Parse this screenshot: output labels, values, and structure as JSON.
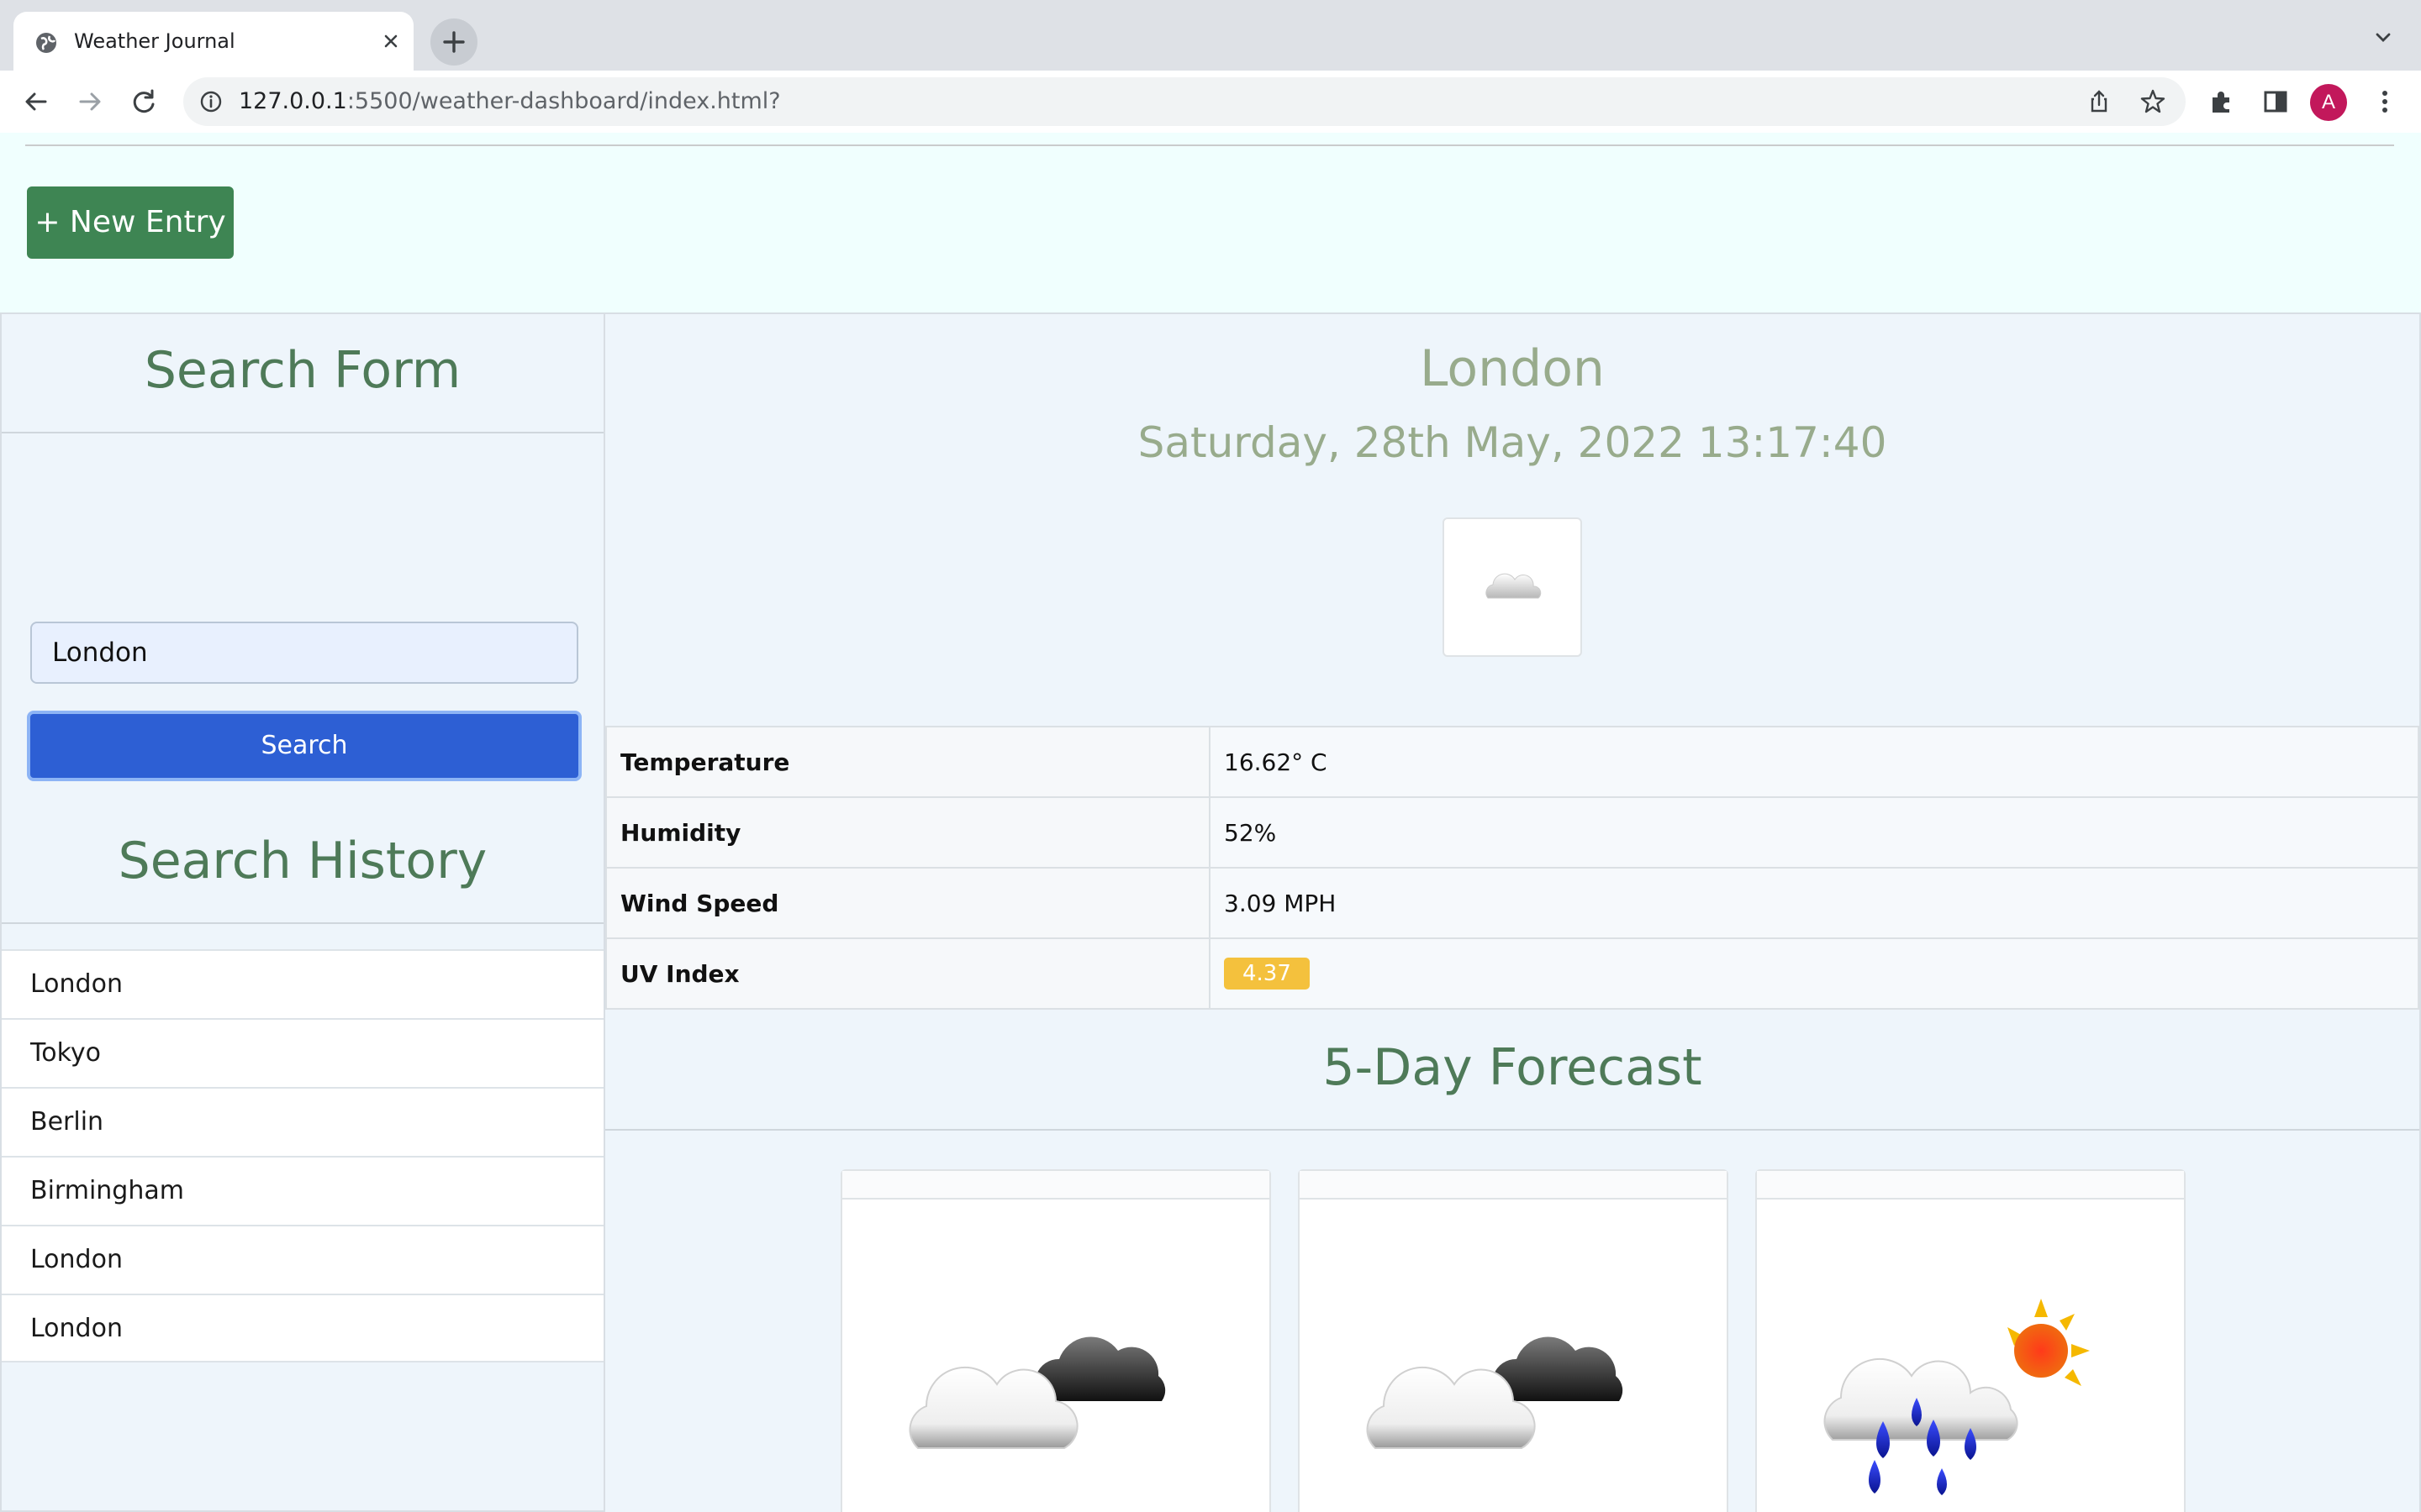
{
  "browser": {
    "tab_title": "Weather Journal",
    "url_host": "127.0.0.1",
    "url_rest": ":5500/weather-dashboard/index.html?",
    "avatar_letter": "A"
  },
  "header": {
    "new_entry_label": "+ New Entry"
  },
  "search": {
    "title": "Search Form",
    "input_value": "London",
    "button_label": "Search"
  },
  "history": {
    "title": "Search History",
    "items": [
      "London",
      "Tokyo",
      "Berlin",
      "Birmingham",
      "London",
      "London"
    ]
  },
  "current": {
    "city": "London",
    "datetime": "Saturday, 28th May, 2022 13:17:40",
    "icon": "cloud-icon",
    "rows": [
      {
        "label": "Temperature",
        "value": "16.62° C"
      },
      {
        "label": "Humidity",
        "value": "52%"
      },
      {
        "label": "Wind Speed",
        "value": "3.09 MPH"
      },
      {
        "label": "UV Index",
        "value": "4.37"
      }
    ],
    "uv_color": "#f4c13d"
  },
  "forecast": {
    "title": "5-Day Forecast",
    "cards": [
      {
        "icon": "broken-clouds-icon"
      },
      {
        "icon": "broken-clouds-icon"
      },
      {
        "icon": "rain-sun-icon"
      }
    ]
  },
  "colors": {
    "accent_green": "#3e8553",
    "heading_green": "#4e7a58",
    "muted_green": "#98ab8c",
    "search_blue": "#2d5fd4"
  }
}
